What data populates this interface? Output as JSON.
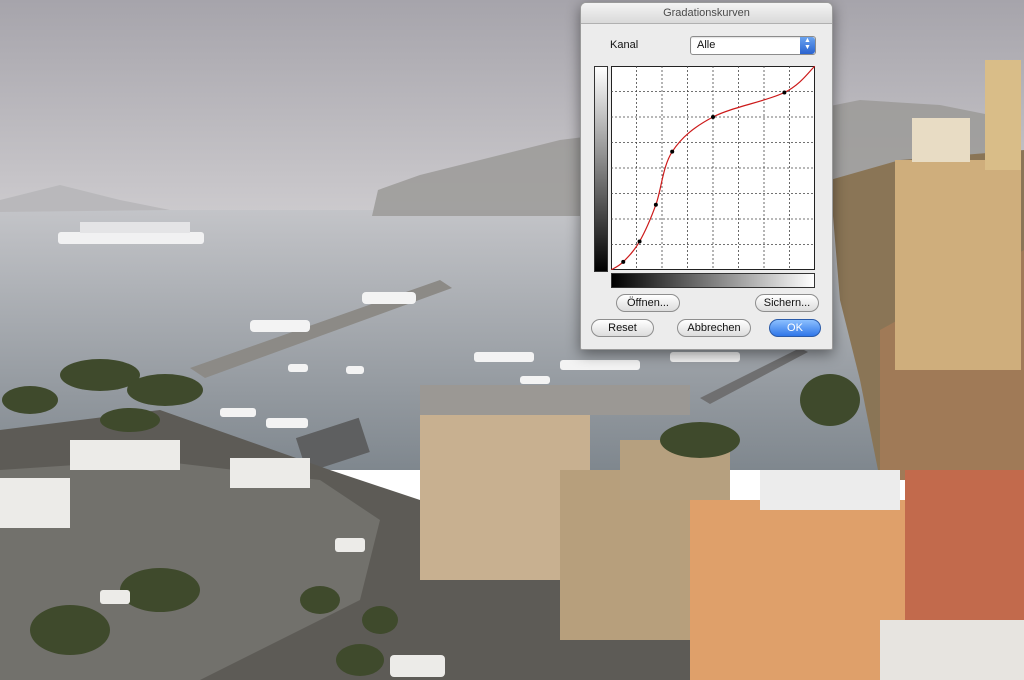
{
  "dialog": {
    "title": "Gradationskurven",
    "channel_label": "Kanal",
    "channel_value": "Alle",
    "curve_points": [
      [
        0,
        0
      ],
      [
        0.06,
        0.04
      ],
      [
        0.14,
        0.14
      ],
      [
        0.22,
        0.32
      ],
      [
        0.3,
        0.58
      ],
      [
        0.5,
        0.75
      ],
      [
        0.85,
        0.87
      ],
      [
        1,
        1
      ]
    ],
    "buttons": {
      "open": "Öffnen...",
      "save": "Sichern...",
      "reset": "Reset",
      "cancel": "Abbrechen",
      "ok": "OK"
    }
  },
  "colors": {
    "curve": "#cc1a1a",
    "ok_button": "#2f76e8"
  },
  "background": {
    "description_icon": "photo-sorrento-harbor"
  }
}
